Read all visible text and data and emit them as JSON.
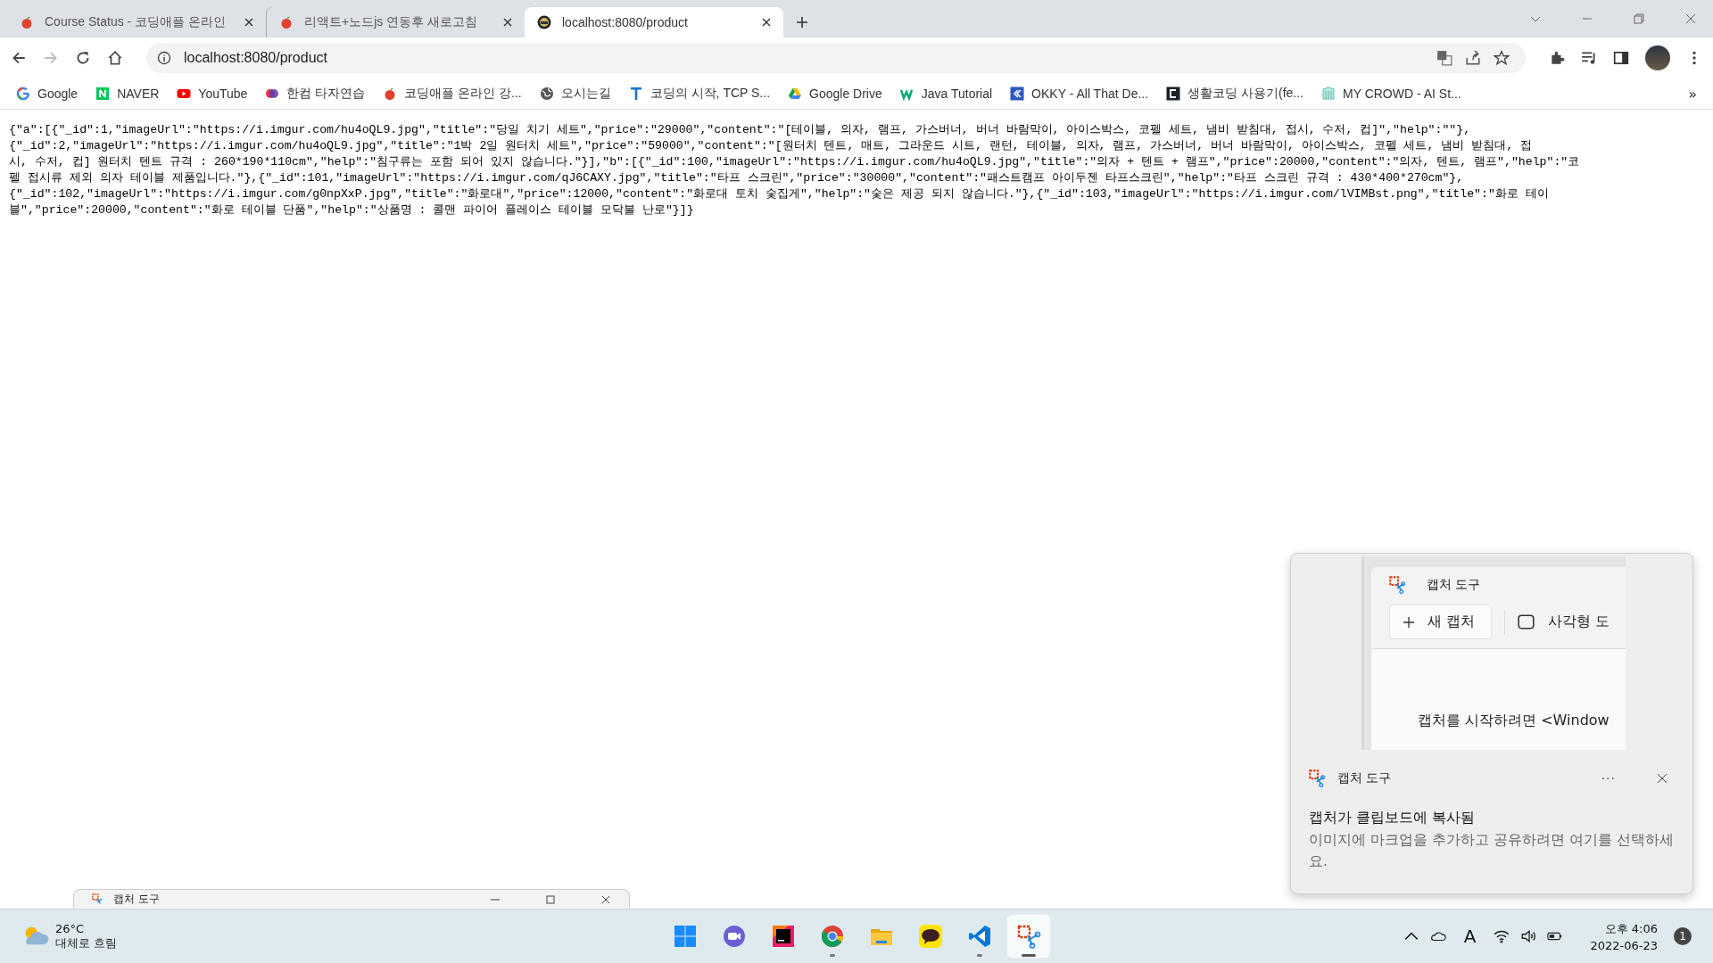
{
  "tabs": [
    {
      "title": "Course Status - 코딩애플 온라인",
      "kind": "fruit",
      "selected": false
    },
    {
      "title": "리액트+노드js 연동후 새로고침",
      "kind": "fruit",
      "selected": false
    },
    {
      "title": "localhost:8080/product",
      "kind": "round",
      "selected": true
    }
  ],
  "address_bar": {
    "url": "localhost:8080/product"
  },
  "bookmarks": [
    {
      "label": "Google",
      "kind": "ring"
    },
    {
      "label": "NAVER",
      "kind": "square"
    },
    {
      "label": "YouTube",
      "kind": "play"
    },
    {
      "label": "한컴 타자연습",
      "kind": "circles"
    },
    {
      "label": "코딩애플 온라인 강...",
      "kind": "fruit"
    },
    {
      "label": "오시는길",
      "kind": "globe"
    },
    {
      "label": "코딩의 시작, TCP S...",
      "kind": "bar"
    },
    {
      "label": "Google Drive",
      "kind": "triangle"
    },
    {
      "label": "Java Tutorial",
      "kind": "zigzag"
    },
    {
      "label": "OKKY - All That De...",
      "kind": "chevron"
    },
    {
      "label": "생활코딩 사용기(fe...",
      "kind": "bracket"
    },
    {
      "label": "MY CROWD - AI St...",
      "kind": "box"
    }
  ],
  "bookmarks_overflow": "»",
  "page": {
    "lines": [
      "{\"a\":[{\"_id\":1,\"imageUrl\":\"https://i.imgur.com/hu4oQL9.jpg\",\"title\":\"당일 치기 세트\",\"price\":\"29000\",\"content\":\"[테이블, 의자, 램프, 가스버너, 버너 바람막이, 아이스박스, 코펠 세트, 냄비 받침대, 접시, 수저, 컵]\",\"help\":\"\"},",
      "{\"_id\":2,\"imageUrl\":\"https://i.imgur.com/hu4oQL9.jpg\",\"title\":\"1박 2일 원터치 세트\",\"price\":\"59000\",\"content\":\"[원터치 텐트, 매트, 그라운드 시트, 랜턴, 테이블, 의자, 램프, 가스버너, 버너 바람막이, 아이스박스, 코펠 세트, 냄비 받침대, 접",
      "시, 수저, 컵] 원터치 텐트 규격 : 260*190*110cm\",\"help\":\"침구류는 포함 되어 있지 않습니다.\"}],\"b\":[{\"_id\":100,\"imageUrl\":\"https://i.imgur.com/hu4oQL9.jpg\",\"title\":\"의자 + 텐트 + 램프\",\"price\":20000,\"content\":\"의자, 텐트, 램프\",\"help\":\"코",
      "펠 접시류 제외 의자 테이블 제품입니다.\"},{\"_id\":101,\"imageUrl\":\"https://i.imgur.com/qJ6CAXY.jpg\",\"title\":\"타프 스크린\",\"price\":\"30000\",\"content\":\"패스트캠프 아이두젠 타프스크린\",\"help\":\"타프 스크린 규격 : 430*400*270cm\"},",
      "{\"_id\":102,\"imageUrl\":\"https://i.imgur.com/g0npXxP.jpg\",\"title\":\"화로대\",\"price\":12000,\"content\":\"화로대 토치 숯집게\",\"help\":\"숯은 제공 되지 않습니다.\"},{\"_id\":103,\"imageUrl\":\"https://i.imgur.com/lVIMBst.png\",\"title\":\"화로 테이",
      "블\",\"price\":20000,\"content\":\"화로 테이블 단품\",\"help\":\"상품명 : 콜맨 파이어 플레이스 테이블 모닥불 난로\"}]}"
    ]
  },
  "snip_window": {
    "title": "캡처 도구"
  },
  "notification": {
    "preview": {
      "title": "캡처 도구",
      "new_button": "새 캡처",
      "mode": "사각형 도",
      "hint": "캡처를 시작하려면 <Window"
    },
    "app": "캡처 도구",
    "more": "···",
    "title": "캡처가 클립보드에 복사됨",
    "body": "이미지에 마크업을 추가하고 공유하려면 여기를 선택하세요."
  },
  "taskbar": {
    "weather": {
      "temp": "26°C",
      "desc": "대체로 흐림"
    },
    "apps": [
      {
        "kind": "start",
        "running": false,
        "selected": false
      },
      {
        "kind": "video",
        "running": false,
        "selected": false
      },
      {
        "kind": "ide",
        "running": false,
        "selected": false
      },
      {
        "kind": "browser",
        "running": true,
        "selected": false
      },
      {
        "kind": "folder",
        "running": false,
        "selected": false
      },
      {
        "kind": "chat",
        "running": false,
        "selected": false
      },
      {
        "kind": "code",
        "running": true,
        "selected": false
      },
      {
        "kind": "snip",
        "running": true,
        "selected": true
      }
    ],
    "tray": {
      "ime": "A",
      "time": "오후 4:06",
      "date": "2022-06-23",
      "badge": "1"
    }
  }
}
